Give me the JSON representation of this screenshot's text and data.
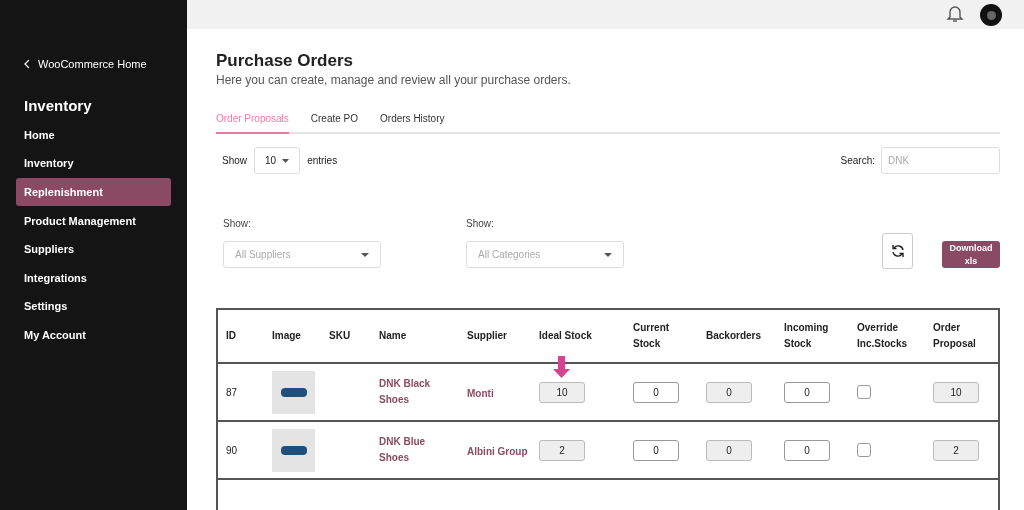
{
  "sidebar": {
    "back_link": "WooCommerce Home",
    "title": "Inventory",
    "items": [
      {
        "label": "Home",
        "selected": false
      },
      {
        "label": "Inventory",
        "selected": false
      },
      {
        "label": "Replenishment",
        "selected": true
      },
      {
        "label": "Product Management",
        "selected": false
      },
      {
        "label": "Suppliers",
        "selected": false
      },
      {
        "label": "Integrations",
        "selected": false
      },
      {
        "label": "Settings",
        "selected": false
      },
      {
        "label": "My Account",
        "selected": false
      }
    ]
  },
  "page": {
    "title": "Purchase Orders",
    "subtitle": "Here you can create, manage and review all your purchase orders."
  },
  "tabs": [
    {
      "label": "Order Proposals",
      "selected": true
    },
    {
      "label": "Create PO",
      "selected": false
    },
    {
      "label": "Orders History",
      "selected": false
    }
  ],
  "entries": {
    "prefix": "Show",
    "value": "10",
    "suffix": "entries"
  },
  "search": {
    "label": "Search:",
    "value": "DNK"
  },
  "filters": [
    {
      "label": "Show:",
      "placeholder": "All Suppliers"
    },
    {
      "label": "Show:",
      "placeholder": "All Categories"
    }
  ],
  "download_button": "Download xls",
  "table": {
    "columns": [
      "ID",
      "Image",
      "SKU",
      "Name",
      "Supplier",
      "Ideal Stock",
      "Current Stock",
      "Backorders",
      "Incoming Stock",
      "Override Inc.Stocks",
      "Order Proposal"
    ],
    "rows": [
      {
        "id": "87",
        "name": "DNK Black Shoes",
        "supplier": "Monti",
        "ideal_stock": "10",
        "current_stock": "0",
        "backorders": "0",
        "incoming_stock": "0",
        "override": false,
        "order_proposal": "10",
        "arrow": true
      },
      {
        "id": "90",
        "name": "DNK Blue Shoes",
        "supplier": "Albini Group",
        "ideal_stock": "2",
        "current_stock": "0",
        "backorders": "0",
        "incoming_stock": "0",
        "override": false,
        "order_proposal": "2",
        "arrow": false
      }
    ]
  }
}
